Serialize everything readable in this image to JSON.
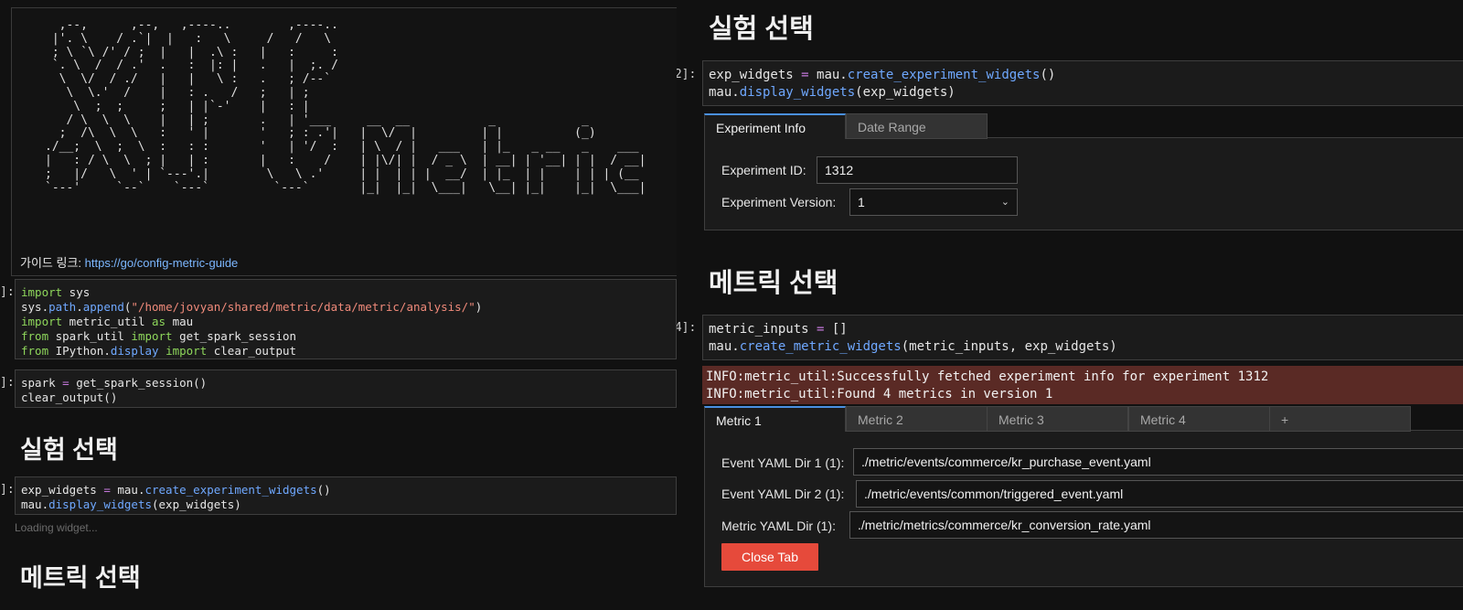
{
  "left": {
    "banner_ascii": "  ,--,      ,--,   ,----..        ,----..\n |'. \\    / .`|  |   :   \\     /   /   \\\n ; \\ `\\ /' / ;  |   |  .\\ :   |   :     :\n `. \\  /  / .'  .   :  |: |   .   |  ;. /\n  \\  \\/  / ./   |   |   \\ :   .   ; /--`\n   \\  \\.'  /    |   : .   /   ;   | ;\n    \\  ;  ;     ;   | |`-'    |   : |\n   / \\  \\  \\    |   | ;       .   | '___     __  __           _            _\n  ;  /\\  \\  \\   :   ' |       '   ; : .'|   |  \\/  |         | |          (_)\n./__;  \\  ;  \\  :   : :       '   | '/  :   | \\  / |   ___   | |_   _ __   _    ___\n|   : / \\  \\  ; |   | :       |   :    /    | |\\/| |  / _ \\  | __| | '__| | |  / __|\n;   |/   \\  ' | `---'.|        \\   \\ .'     | |  | | |  __/  | |_  | |    | | | (__\n`---'     `--`    `---`         `---`       |_|  |_|  \\___|   \\__| |_|    |_|  \\___|",
    "guide_label": "가이드 링크: ",
    "guide_url": "https://go/config-metric-guide",
    "cell_imports": {
      "prompt": "]:",
      "lines": [
        [
          {
            "t": "import",
            "c": "kw"
          },
          {
            "t": " sys"
          }
        ],
        [
          {
            "t": "sys."
          },
          {
            "t": "path",
            "c": "fn"
          },
          {
            "t": "."
          },
          {
            "t": "append",
            "c": "fn"
          },
          {
            "t": "("
          },
          {
            "t": "\"/home/jovyan/shared/metric/data/metric/analysis/\"",
            "c": "st"
          },
          {
            "t": ")"
          }
        ],
        [
          {
            "t": "import",
            "c": "kw"
          },
          {
            "t": " metric_util "
          },
          {
            "t": "as",
            "c": "kw"
          },
          {
            "t": " mau"
          }
        ],
        [
          {
            "t": "from",
            "c": "kw"
          },
          {
            "t": " spark_util "
          },
          {
            "t": "import",
            "c": "kw"
          },
          {
            "t": " get_spark_session"
          }
        ],
        [
          {
            "t": "from",
            "c": "kw"
          },
          {
            "t": " IPython."
          },
          {
            "t": "display",
            "c": "fn"
          },
          {
            "t": " "
          },
          {
            "t": "import",
            "c": "kw"
          },
          {
            "t": " clear_output"
          }
        ]
      ]
    },
    "cell_spark": {
      "prompt": "]:",
      "lines": [
        [
          {
            "t": "spark "
          },
          {
            "t": "=",
            "c": "eq"
          },
          {
            "t": " get_spark_session()"
          }
        ],
        [
          {
            "t": "clear_output()"
          }
        ]
      ]
    },
    "heading_experiment": "실험 선택",
    "cell_exp": {
      "prompt": "]:",
      "lines": [
        [
          {
            "t": "exp_widgets "
          },
          {
            "t": "=",
            "c": "eq"
          },
          {
            "t": " mau."
          },
          {
            "t": "create_experiment_widgets",
            "c": "fn"
          },
          {
            "t": "()"
          }
        ],
        [
          {
            "t": "mau."
          },
          {
            "t": "display_widgets",
            "c": "fn"
          },
          {
            "t": "(exp_widgets)"
          }
        ]
      ]
    },
    "loading_text": "Loading widget...",
    "heading_metric": "메트릭 선택"
  },
  "right": {
    "heading_experiment": "실험 선택",
    "cell_exp": {
      "prompt": "[2]:",
      "lines": [
        [
          {
            "t": "exp_widgets "
          },
          {
            "t": "=",
            "c": "eq"
          },
          {
            "t": " mau."
          },
          {
            "t": "create_experiment_widgets",
            "c": "fn"
          },
          {
            "t": "()"
          }
        ],
        [
          {
            "t": "mau."
          },
          {
            "t": "display_widgets",
            "c": "fn"
          },
          {
            "t": "(exp_widgets)"
          }
        ]
      ]
    },
    "exp_tabs": [
      "Experiment Info",
      "Date Range"
    ],
    "experiment_id_label": "Experiment ID:",
    "experiment_id_value": "1312",
    "experiment_version_label": "Experiment Version:",
    "experiment_version_value": "1",
    "heading_metric": "메트릭 선택",
    "cell_metric": {
      "prompt": "[4]:",
      "lines": [
        [
          {
            "t": "metric_inputs "
          },
          {
            "t": "=",
            "c": "eq"
          },
          {
            "t": " []"
          }
        ],
        [
          {
            "t": "mau."
          },
          {
            "t": "create_metric_widgets",
            "c": "fn"
          },
          {
            "t": "(metric_inputs, exp_widgets)"
          }
        ]
      ]
    },
    "log_lines": [
      "INFO:metric_util:Successfully fetched experiment info for experiment 1312",
      "INFO:metric_util:Found 4 metrics in version 1"
    ],
    "metric_tabs": [
      "Metric 1",
      "Metric 2",
      "Metric 3",
      "Metric 4",
      "+"
    ],
    "event_yaml_1_label": "Event YAML Dir 1 (1):",
    "event_yaml_1_value": "./metric/events/commerce/kr_purchase_event.yaml",
    "event_yaml_2_label": "Event YAML Dir 2 (1):",
    "event_yaml_2_value": "./metric/events/common/triggered_event.yaml",
    "metric_yaml_label": "Metric YAML Dir (1):",
    "metric_yaml_value": "./metric/metrics/commerce/kr_conversion_rate.yaml",
    "close_tab_label": "Close Tab",
    "colors": {
      "accent": "#4a90e2",
      "close_button": "#e64a3b",
      "log_bg": "#5a2a25",
      "keyword": "#8ed65b",
      "function": "#6fa8ff",
      "string": "#f08a7a"
    }
  }
}
